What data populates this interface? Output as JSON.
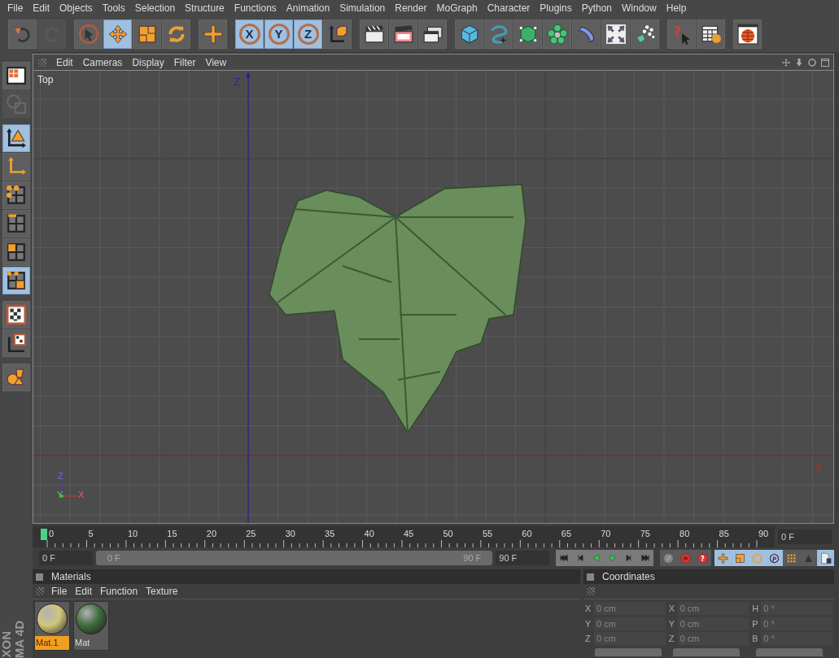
{
  "menu_bar": [
    "File",
    "Edit",
    "Objects",
    "Tools",
    "Selection",
    "Structure",
    "Functions",
    "Animation",
    "Simulation",
    "Render",
    "MoGraph",
    "Character",
    "Plugins",
    "Python",
    "Window",
    "Help"
  ],
  "toolbar": [
    {
      "kind": "undo",
      "selected": false,
      "disabled": false
    },
    {
      "kind": "redo",
      "selected": false,
      "disabled": true
    },
    {
      "kind": "gap"
    },
    {
      "kind": "select",
      "selected": false,
      "disabled": false
    },
    {
      "kind": "move",
      "selected": true,
      "disabled": false
    },
    {
      "kind": "scale",
      "selected": false,
      "disabled": false
    },
    {
      "kind": "rotate",
      "selected": false,
      "disabled": false
    },
    {
      "kind": "gap"
    },
    {
      "kind": "add",
      "selected": false,
      "disabled": false
    },
    {
      "kind": "gap"
    },
    {
      "kind": "axis_letter",
      "label": "X",
      "selected": true,
      "disabled": false
    },
    {
      "kind": "axis_letter",
      "label": "Y",
      "selected": true,
      "disabled": false
    },
    {
      "kind": "axis_letter",
      "label": "Z",
      "selected": true,
      "disabled": false
    },
    {
      "kind": "coord",
      "selected": false,
      "disabled": false
    },
    {
      "kind": "gap"
    },
    {
      "kind": "render_view",
      "selected": false,
      "disabled": false
    },
    {
      "kind": "render_active",
      "selected": false,
      "disabled": false
    },
    {
      "kind": "render_settings",
      "selected": false,
      "disabled": false
    },
    {
      "kind": "gap"
    },
    {
      "kind": "cube",
      "selected": false,
      "disabled": false
    },
    {
      "kind": "spline",
      "selected": false,
      "disabled": false
    },
    {
      "kind": "cage",
      "selected": false,
      "disabled": false
    },
    {
      "kind": "array",
      "selected": false,
      "disabled": false
    },
    {
      "kind": "deformer",
      "selected": false,
      "disabled": false
    },
    {
      "kind": "scene",
      "selected": false,
      "disabled": false
    },
    {
      "kind": "particles",
      "selected": false,
      "disabled": false
    },
    {
      "kind": "gap"
    },
    {
      "kind": "help",
      "label": "?",
      "selected": false,
      "disabled": false
    },
    {
      "kind": "table_help",
      "selected": false,
      "disabled": false
    },
    {
      "kind": "gap"
    },
    {
      "kind": "globe",
      "selected": false,
      "disabled": false
    }
  ],
  "side_toolbar": [
    {
      "kind": "layout",
      "selected": false,
      "disabled": false
    },
    {
      "kind": "model",
      "selected": false,
      "disabled": true
    },
    {
      "kind": "gap"
    },
    {
      "kind": "object",
      "selected": true,
      "disabled": false
    },
    {
      "kind": "axis",
      "selected": false,
      "disabled": false
    },
    {
      "kind": "points",
      "selected": false,
      "disabled": false
    },
    {
      "kind": "edges",
      "selected": false,
      "disabled": false
    },
    {
      "kind": "polygons",
      "selected": false,
      "disabled": false
    },
    {
      "kind": "uvw",
      "selected": true,
      "disabled": false
    },
    {
      "kind": "gap"
    },
    {
      "kind": "texture",
      "selected": false,
      "disabled": false
    },
    {
      "kind": "texture_axis",
      "selected": false,
      "disabled": false
    },
    {
      "kind": "gap"
    },
    {
      "kind": "sculpt",
      "selected": false,
      "disabled": false
    }
  ],
  "brand_lines": [
    "XON",
    "MA 4D"
  ],
  "viewport": {
    "menu": [
      "Edit",
      "Cameras",
      "Display",
      "Filter",
      "View"
    ],
    "title": "Top",
    "z_axis_label": "Z",
    "x_axis_label": "X",
    "gizmo_labels": [
      "Z",
      "Y",
      "X"
    ]
  },
  "timeline": {
    "ticks": [
      "0",
      "5",
      "10",
      "15",
      "20",
      "25",
      "30",
      "35",
      "40",
      "45",
      "50",
      "55",
      "60",
      "65",
      "70",
      "75",
      "80",
      "85",
      "90"
    ],
    "current_frame": "0 F",
    "start_field": "0 F",
    "range_start": "0 F",
    "range_end": "90 F",
    "end_field": "90 F",
    "range_slider": {
      "level": 1
    }
  },
  "transport": [
    {
      "kind": "first"
    },
    {
      "kind": "prev"
    },
    {
      "kind": "play_back"
    },
    {
      "kind": "play"
    },
    {
      "kind": "next"
    },
    {
      "kind": "last"
    }
  ],
  "key_tools": [
    {
      "kind": "key",
      "selected": false
    },
    {
      "kind": "record",
      "selected": false
    },
    {
      "kind": "auto",
      "label": "?",
      "selected": false
    },
    {
      "kind": "pos",
      "selected": true
    },
    {
      "kind": "scl",
      "selected": true
    },
    {
      "kind": "rot",
      "selected": true
    },
    {
      "kind": "param",
      "label": "P",
      "selected": true
    },
    {
      "kind": "pla",
      "selected": false
    },
    {
      "kind": "point",
      "selected": false
    },
    {
      "kind": "timeline",
      "selected": true
    }
  ],
  "materials": {
    "title": "Materials",
    "menu": [
      "File",
      "Edit",
      "Function",
      "Texture"
    ],
    "items": [
      {
        "name": "Mat.1",
        "selected": true,
        "color": "#d2c57c"
      },
      {
        "name": "Mat",
        "selected": false,
        "color": "#3f6b3e"
      }
    ]
  },
  "coordinates": {
    "title": "Coordinates",
    "rows": [
      {
        "cells": [
          {
            "axis": "X",
            "value": "0 cm"
          },
          {
            "axis": "X",
            "value": "0 cm"
          },
          {
            "axis": "H",
            "value": "0 °"
          }
        ]
      },
      {
        "cells": [
          {
            "axis": "Y",
            "value": "0 cm"
          },
          {
            "axis": "Y",
            "value": "0 cm"
          },
          {
            "axis": "P",
            "value": "0 °"
          }
        ]
      },
      {
        "cells": [
          {
            "axis": "Z",
            "value": "0 cm"
          },
          {
            "axis": "Z",
            "value": "0 cm"
          },
          {
            "axis": "B",
            "value": "0 °"
          }
        ]
      }
    ]
  }
}
